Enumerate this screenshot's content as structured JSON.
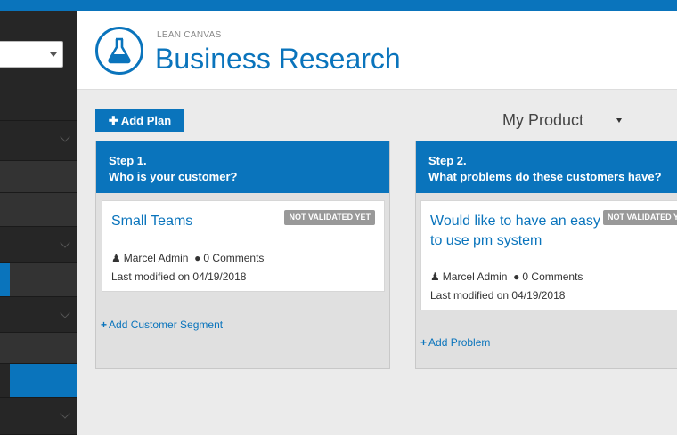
{
  "header": {
    "subtitle": "LEAN CANVAS",
    "title": "Business Research"
  },
  "toolbar": {
    "add_plan_label": "Add Plan",
    "product_select_value": "My Product"
  },
  "columns": [
    {
      "step": "Step 1.",
      "question": "Who is your customer?",
      "card": {
        "title": "Small Teams",
        "badge": "NOT VALIDATED YET",
        "author": "Marcel Admin",
        "comments": "0 Comments",
        "modified": "Last modified on 04/19/2018"
      },
      "add_label": "Add Customer Segment"
    },
    {
      "step": "Step 2.",
      "question": "What problems do these customers have?",
      "card": {
        "title_line1": "Would like to have an easy",
        "title_line2": "to use pm system",
        "badge": "NOT VALIDATED YET",
        "author": "Marcel Admin",
        "comments": "0 Comments",
        "modified": "Last modified on 04/19/2018"
      },
      "add_label": "Add Problem"
    }
  ],
  "colors": {
    "brand": "#0a74bc",
    "sidebar": "#262626",
    "badge": "#999999"
  }
}
